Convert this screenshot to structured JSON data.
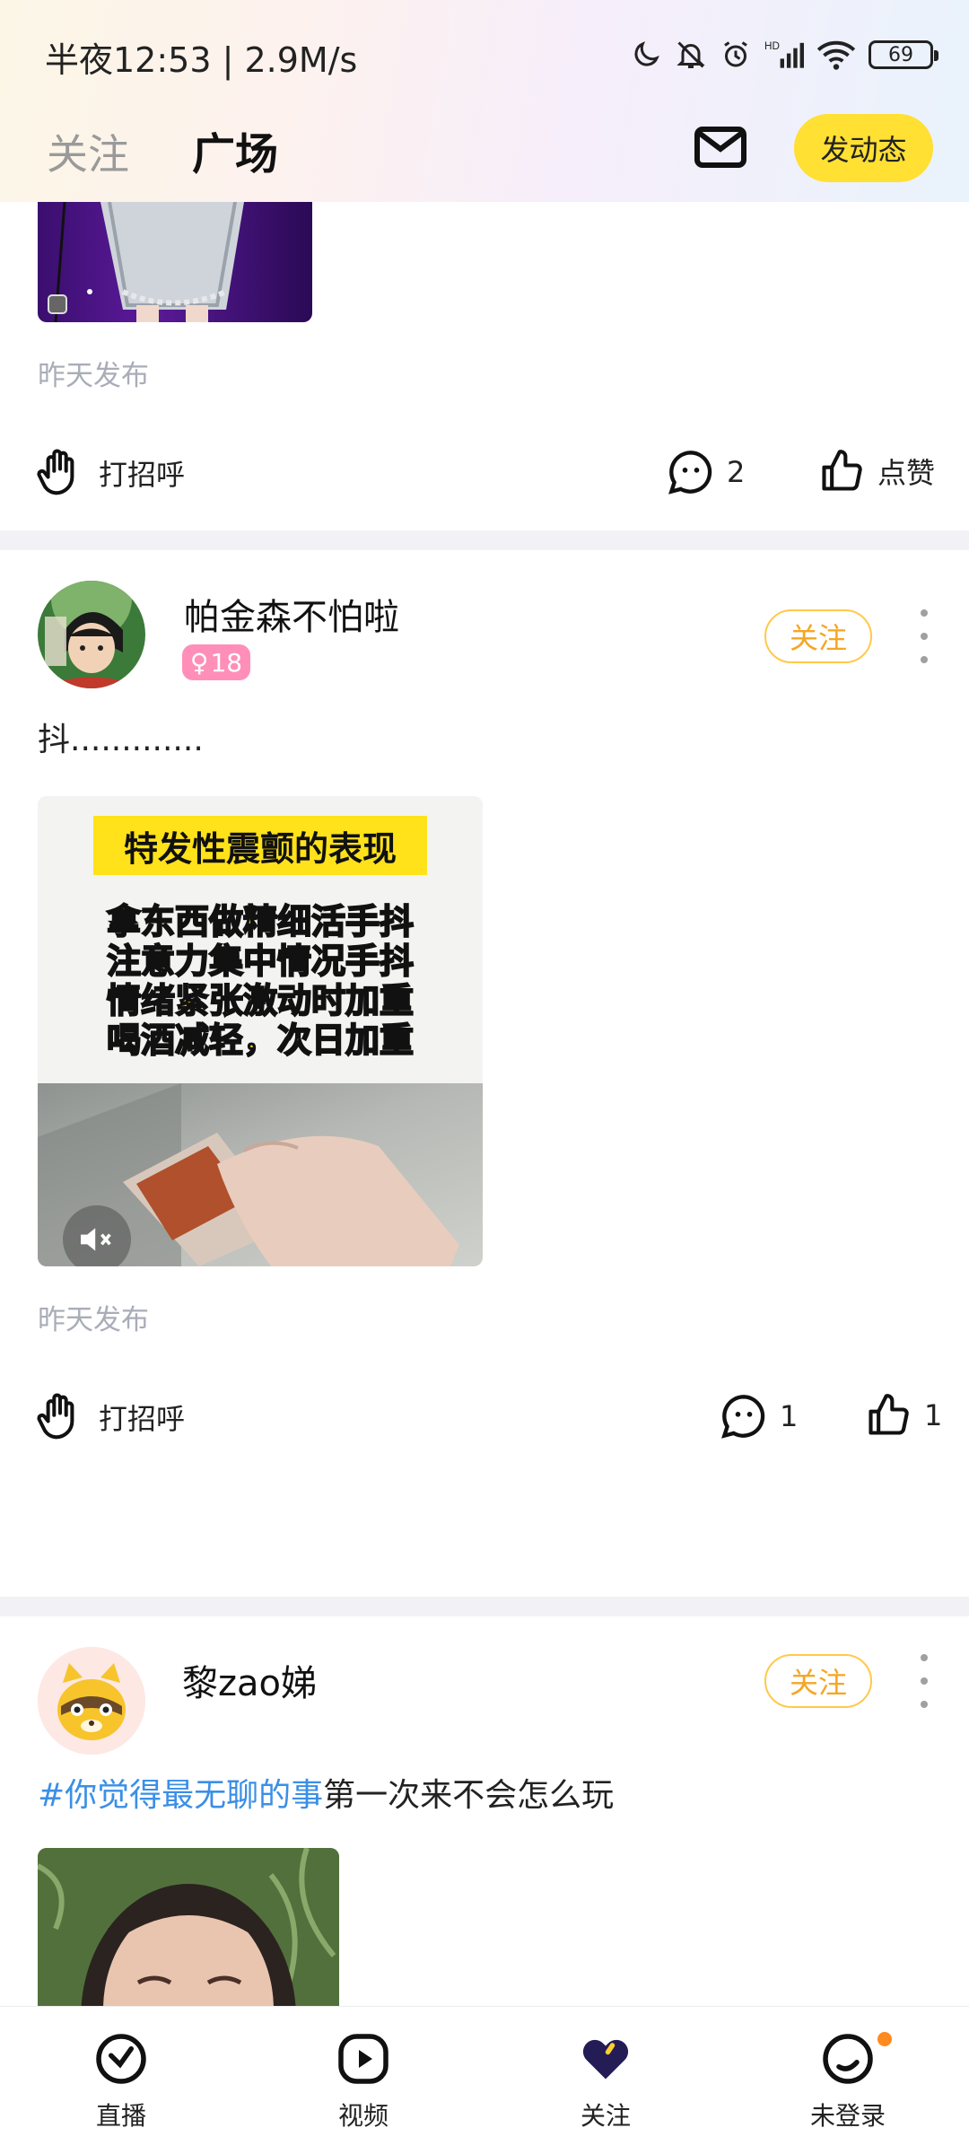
{
  "status_bar": {
    "time": "半夜12:53 | 2.9M/s",
    "battery": "69"
  },
  "header": {
    "tabs": [
      {
        "label": "关注",
        "active": false
      },
      {
        "label": "广场",
        "active": true
      }
    ],
    "post_button": "发动态"
  },
  "posts": [
    {
      "time": "昨天发布",
      "greet": "打招呼",
      "comments": "2",
      "like": "点赞"
    },
    {
      "username": "帕金森不怕啦",
      "gender_age": "18",
      "follow": "关注",
      "text": "抖.............",
      "video_title": "特发性震颤的表现",
      "video_lines": [
        "拿东西做精细活手抖",
        "注意力集中情况手抖",
        "情绪紧张激动时加重",
        "喝酒减轻，次日加重"
      ],
      "time": "昨天发布",
      "greet": "打招呼",
      "comments": "1",
      "likes": "1"
    },
    {
      "username": "黎zao娣",
      "follow": "关注",
      "hashtag": "#你觉得最无聊的事",
      "text": "第一次来不会怎么玩"
    }
  ],
  "bottom_nav": [
    {
      "label": "直播",
      "icon": "live-icon"
    },
    {
      "label": "视频",
      "icon": "video-icon"
    },
    {
      "label": "关注",
      "icon": "heart-icon"
    },
    {
      "label": "未登录",
      "icon": "profile-icon"
    }
  ],
  "colors": {
    "accent_yellow": "#ffe033",
    "follow_orange": "#f5a623",
    "hashtag_blue": "#3b8fe6",
    "badge_pink": "#ff8fb8"
  }
}
